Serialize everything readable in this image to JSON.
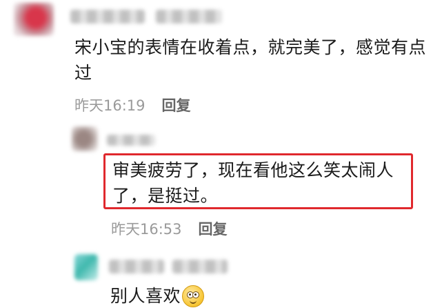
{
  "comment": {
    "text": "宋小宝的表情在收着点，就完美了，感觉有点过",
    "time": "昨天16:19",
    "reply_label": "回复"
  },
  "replies": [
    {
      "text": "审美疲劳了，现在看他这么笑太闹人了，是挺过。",
      "time": "昨天16:53",
      "reply_label": "回复",
      "highlight_color": "#e0282d"
    },
    {
      "text": "别人喜欢",
      "emoji": "grinning-face-icon"
    }
  ],
  "colors": {
    "text": "#1a1a1a",
    "meta_time": "#9a9a9a",
    "meta_reply": "#666666",
    "highlight": "#e0282d"
  }
}
